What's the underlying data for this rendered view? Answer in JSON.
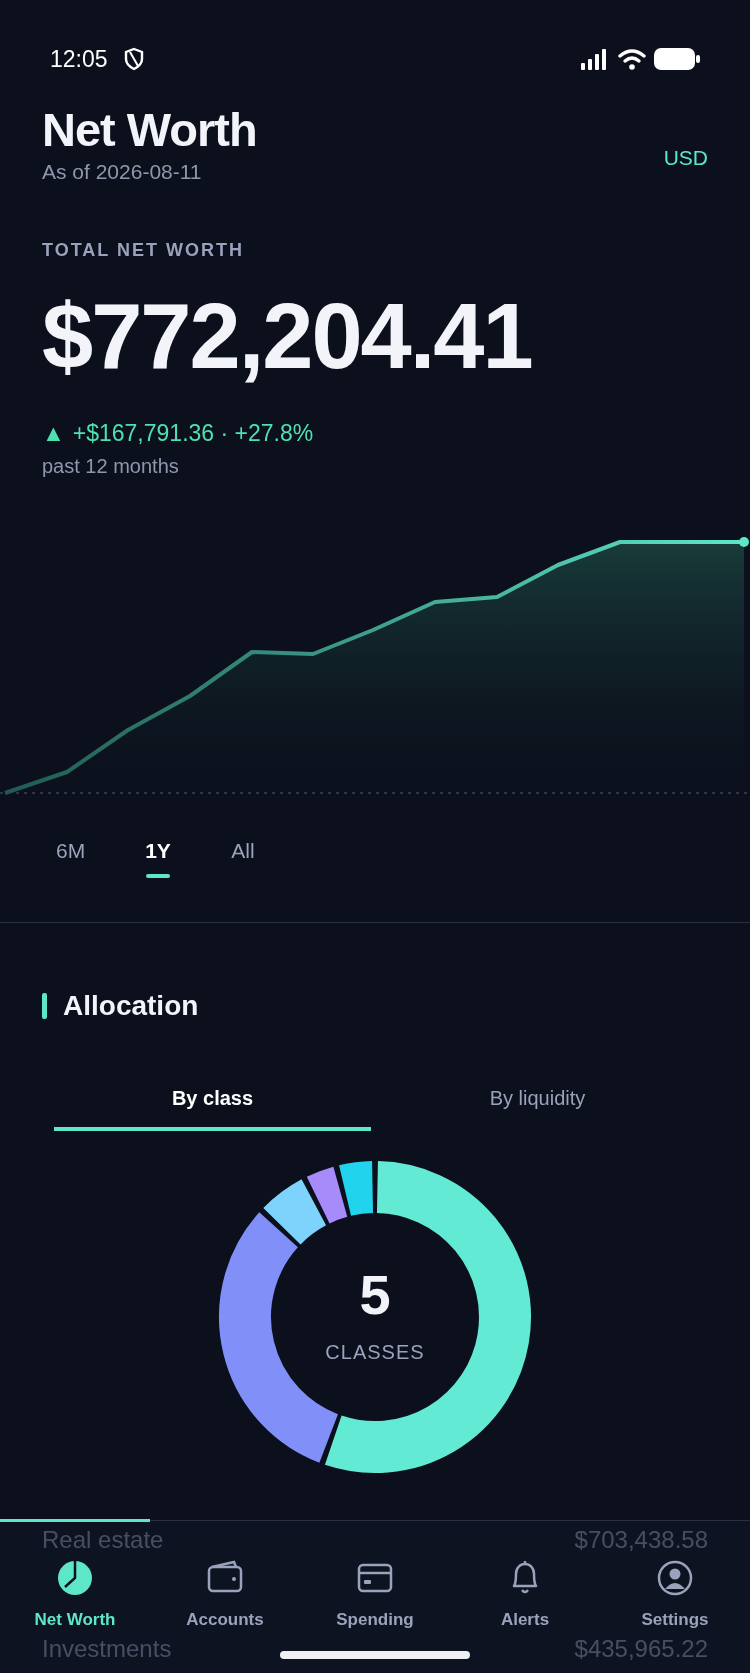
{
  "status_bar": {
    "time": "12:05"
  },
  "header": {
    "title": "Net Worth",
    "as_of": "As of 2026-08-11",
    "currency": "USD"
  },
  "summary": {
    "label": "TOTAL NET WORTH",
    "amount": "$772,204.41",
    "change_arrow": "▲",
    "change": "+$167,791.36 · +27.8%",
    "period": "past 12 months"
  },
  "ranges": [
    {
      "label": "6M",
      "selected": false
    },
    {
      "label": "1Y",
      "selected": true
    },
    {
      "label": "All",
      "selected": false
    }
  ],
  "allocation": {
    "title": "Allocation",
    "tabs": [
      {
        "label": "By class",
        "selected": true
      },
      {
        "label": "By liquidity",
        "selected": false
      }
    ],
    "center_value": "5",
    "center_label": "CLASSES"
  },
  "holdings": [
    {
      "name": "Real estate",
      "value": "$703,438.58"
    },
    {
      "name": "Investments",
      "value": "$435,965.22"
    }
  ],
  "nav": [
    {
      "label": "Net Worth",
      "selected": true
    },
    {
      "label": "Accounts",
      "selected": false
    },
    {
      "label": "Spending",
      "selected": false
    },
    {
      "label": "Alerts",
      "selected": false
    },
    {
      "label": "Settings",
      "selected": false
    }
  ]
}
